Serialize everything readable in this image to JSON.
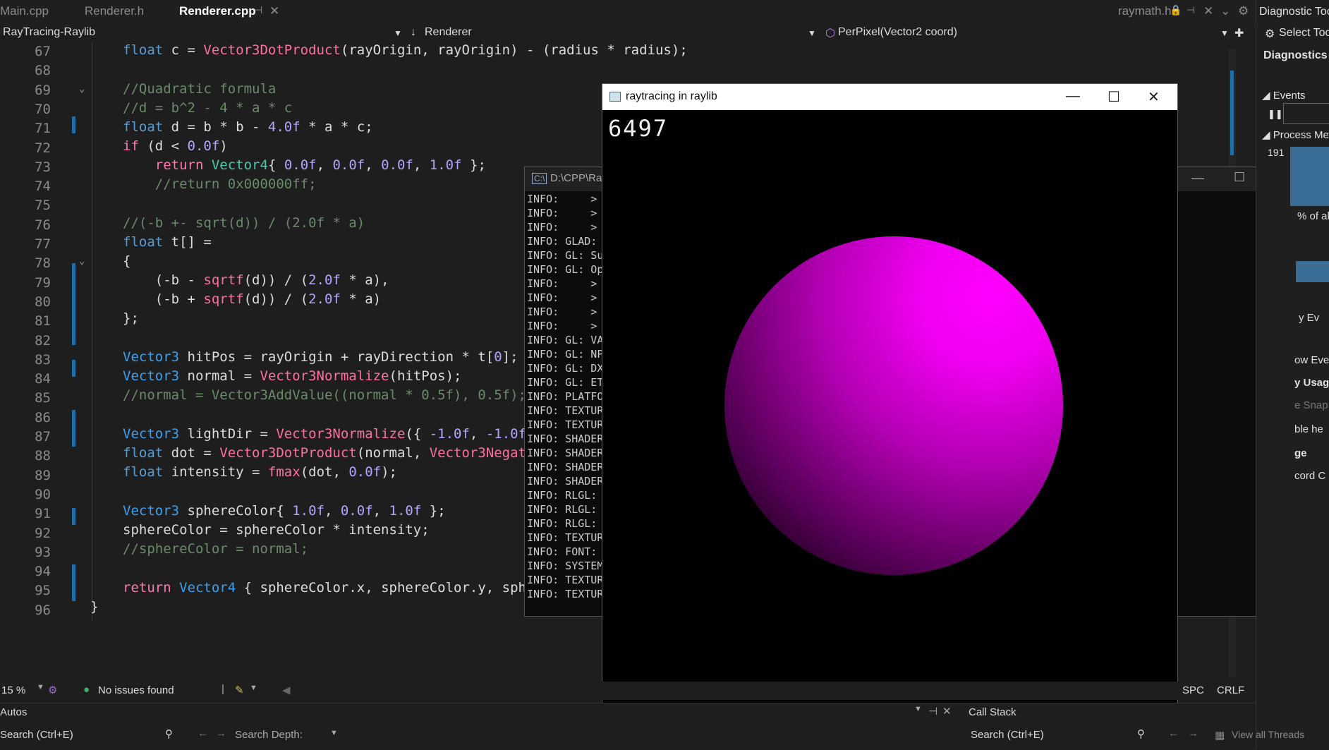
{
  "tabs": [
    "Main.cpp",
    "Renderer.h",
    "Renderer.cpp",
    "raymath.h"
  ],
  "nav": {
    "project": "RayTracing-Raylib",
    "scope": "Renderer",
    "function": "PerPixel(Vector2 coord)"
  },
  "editor": {
    "line_numbers": [
      "67",
      "68",
      "69",
      "70",
      "71",
      "72",
      "73",
      "74",
      "75",
      "76",
      "77",
      "78",
      "79",
      "80",
      "81",
      "82",
      "83",
      "84",
      "85",
      "86",
      "87",
      "88",
      "89",
      "90",
      "91",
      "92",
      "93",
      "94",
      "95",
      "96"
    ],
    "lines": {
      "l67": "float c = Vector3DotProduct(rayOrigin, rayOrigin) - (radius * radius);",
      "l69": "//Quadratic formula",
      "l70": "//d = b^2 - 4 * a * c",
      "l71": "float d = b * b - 4.0f * a * c;",
      "l72": "if (d < 0.0f)",
      "l73": "    return Vector4{ 0.0f, 0.0f, 0.0f, 1.0f };",
      "l74": "    //return 0x000000ff;",
      "l76": "//(-b +- sqrt(d)) / (2.0f * a)",
      "l77": "float t[] =",
      "l78": "{",
      "l79": "    (-b - sqrtf(d)) / (2.0f * a),",
      "l80": "    (-b + sqrtf(d)) / (2.0f * a)",
      "l81": "};",
      "l83": "Vector3 hitPos = rayOrigin + rayDirection * t[0];",
      "l84": "Vector3 normal = Vector3Normalize(hitPos);",
      "l85": "//normal = Vector3AddValue((normal * 0.5f), 0.5f);",
      "l87": "Vector3 lightDir = Vector3Normalize({ -1.0f, -1.0f",
      "l88": "float dot = Vector3DotProduct(normal, Vector3Negat",
      "l89": "float intensity = fmax(dot, 0.0f);",
      "l91": "Vector3 sphereColor{ 1.0f, 0.0f, 1.0f };",
      "l92": "sphereColor = sphereColor * intensity;",
      "l93": "//sphereColor = normal;",
      "l95": "return Vector4 { sphereColor.x, sphereColor.y, sph",
      "l96": "}"
    }
  },
  "raywindow": {
    "title": "raytracing in raylib",
    "fps": "6497",
    "sphere_color": "#ff00ff"
  },
  "console": {
    "title": "D:\\CPP\\Ray",
    "lines": [
      "INFO:     >",
      "INFO:     >",
      "INFO:     >",
      "INFO: GLAD:",
      "INFO: GL: Su",
      "INFO: GL: Op",
      "INFO:     >",
      "INFO:     >",
      "INFO:     >",
      "INFO:     >",
      "INFO: GL: VA",
      "INFO: GL: NP",
      "INFO: GL: DX",
      "INFO: GL: ET",
      "INFO: PLATFO",
      "INFO: TEXTUR",
      "INFO: TEXTUR",
      "INFO: SHADER",
      "INFO: SHADER",
      "INFO: SHADER",
      "INFO: SHADER",
      "INFO: RLGL:",
      "INFO: RLGL:",
      "INFO: RLGL:",
      "INFO: TEXTUR",
      "INFO: FONT:",
      "INFO: SYSTEM",
      "INFO: TEXTUR",
      "INFO: TEXTUR"
    ]
  },
  "diagnostics": {
    "title": "Diagnostic Too",
    "select_tool": "Select Too",
    "sessions": "Diagnostics se",
    "events": "Events",
    "process_memory": "Process Mem",
    "mem_value": "191",
    "pct": "% of al",
    "tabs_frag": "y  Ev",
    "items": [
      "ow Eve",
      "y Usag",
      "e Snap",
      "ble he",
      "ge",
      "cord C"
    ]
  },
  "status": {
    "zoom": "15 %",
    "issues": "No issues found",
    "spc": "SPC",
    "crlf": "CRLF"
  },
  "bottom": {
    "autos": "Autos",
    "search": "Search (Ctrl+E)",
    "search_depth": "Search Depth:",
    "call_stack": "Call Stack",
    "search2": "Search (Ctrl+E)",
    "view_threads": "View all Threads"
  }
}
